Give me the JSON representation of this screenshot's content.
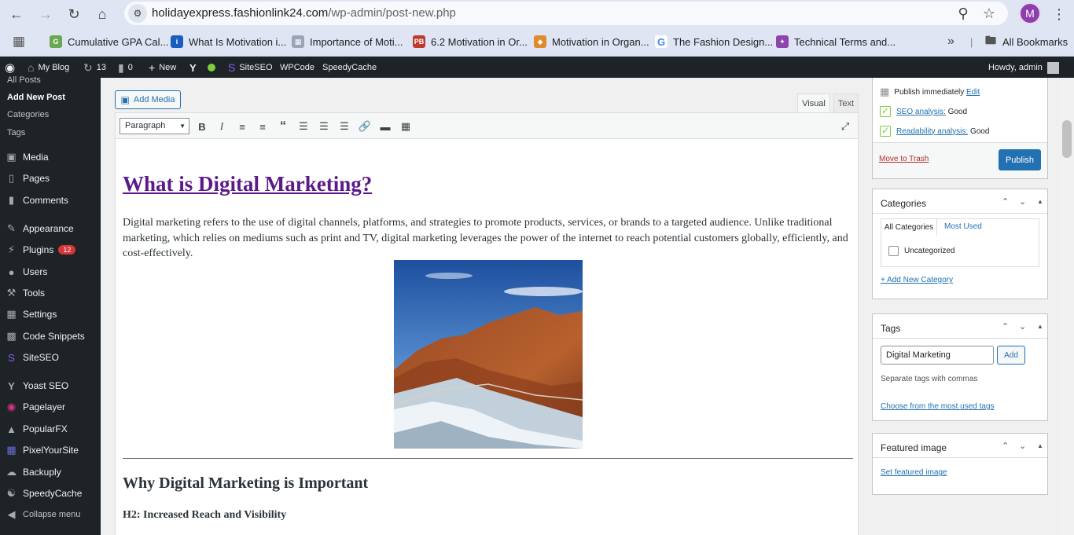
{
  "browser": {
    "url_host": "holidayexpress.fashionlink24.com",
    "url_path": "/wp-admin/post-new.php",
    "profile_initial": "M",
    "bookmarks": [
      {
        "label": "Cumulative GPA Cal...",
        "icon": "gpa-favicon",
        "color": "#6aa84f"
      },
      {
        "label": "What Is Motivation i...",
        "icon": "info-favicon",
        "color": "#1a5dbf"
      },
      {
        "label": "Importance of Moti...",
        "icon": "image-favicon",
        "color": "#9aa5b8"
      },
      {
        "label": "6.2 Motivation in Or...",
        "icon": "pb-favicon",
        "color": "#c0392b"
      },
      {
        "label": "Motivation in Organ...",
        "icon": "app-favicon",
        "color": "#e08a2e"
      },
      {
        "label": "The Fashion Design...",
        "icon": "google-favicon",
        "color": "#4285f4"
      },
      {
        "label": "Technical Terms and...",
        "icon": "star-favicon",
        "color": "#8e44ad"
      }
    ],
    "bookmarks_overflow": "»",
    "all_bookmarks": "All Bookmarks"
  },
  "adminbar": {
    "site_name": "My Blog",
    "updates_count": "13",
    "comments_count": "0",
    "new_label": "New",
    "siteseo": "SiteSEO",
    "wpcode": "WPCode",
    "speedycache": "SpeedyCache",
    "howdy": "Howdy, admin"
  },
  "menu": {
    "posts_sub": [
      "All Posts",
      "Add New Post",
      "Categories",
      "Tags"
    ],
    "items": [
      {
        "label": "Media",
        "icon": "media-icon"
      },
      {
        "label": "Pages",
        "icon": "pages-icon"
      },
      {
        "label": "Comments",
        "icon": "comments-icon"
      },
      {
        "label": "Appearance",
        "icon": "appearance-icon"
      },
      {
        "label": "Plugins",
        "icon": "plugins-icon",
        "badge": "12"
      },
      {
        "label": "Users",
        "icon": "users-icon"
      },
      {
        "label": "Tools",
        "icon": "tools-icon"
      },
      {
        "label": "Settings",
        "icon": "settings-icon"
      },
      {
        "label": "Code Snippets",
        "icon": "code-icon"
      },
      {
        "label": "SiteSEO",
        "icon": "siteseo-icon"
      },
      {
        "label": "Yoast SEO",
        "icon": "yoast-icon"
      },
      {
        "label": "Pagelayer",
        "icon": "pagelayer-icon"
      },
      {
        "label": "PopularFX",
        "icon": "popularfx-icon"
      },
      {
        "label": "PixelYourSite",
        "icon": "pixel-icon"
      },
      {
        "label": "Backuply",
        "icon": "backup-icon"
      },
      {
        "label": "SpeedyCache",
        "icon": "speedycache-icon"
      },
      {
        "label": "Collapse menu",
        "icon": "collapse-icon"
      }
    ]
  },
  "editor": {
    "add_media": "Add Media",
    "tab_visual": "Visual",
    "tab_text": "Text",
    "format": "Paragraph",
    "title": "What is Digital Marketing?",
    "para1": "Digital marketing refers to the use of digital channels, platforms, and strategies to promote products, services, or brands to a targeted audience. Unlike traditional marketing, which relies on mediums such as print and TV, digital marketing leverages the power of the internet to reach potential customers globally, efficiently, and cost-effectively.",
    "h2": "Why Digital Marketing is Important",
    "h3": "H2: Increased Reach and Visibility"
  },
  "publish": {
    "publish_immediately": "Publish immediately",
    "edit": "Edit",
    "seo_label": "SEO analysis:",
    "seo_value": "Good",
    "read_label": "Readability analysis:",
    "read_value": "Good",
    "trash": "Move to Trash",
    "publish": "Publish"
  },
  "categories": {
    "title": "Categories",
    "tab_all": "All Categories",
    "tab_most": "Most Used",
    "item": "Uncategorized",
    "add_new": "+ Add New Category"
  },
  "tags": {
    "title": "Tags",
    "input_value": "Digital Marketing",
    "add": "Add",
    "hint": "Separate tags with commas",
    "choose": "Choose from the most used tags"
  },
  "featured": {
    "title": "Featured image",
    "set": "Set featured image"
  },
  "colors": {
    "admin_dark": "#1d2327",
    "wp_blue": "#2271b1",
    "title_purple": "#5b1a8a",
    "yoast_green": "#7ad03a"
  }
}
